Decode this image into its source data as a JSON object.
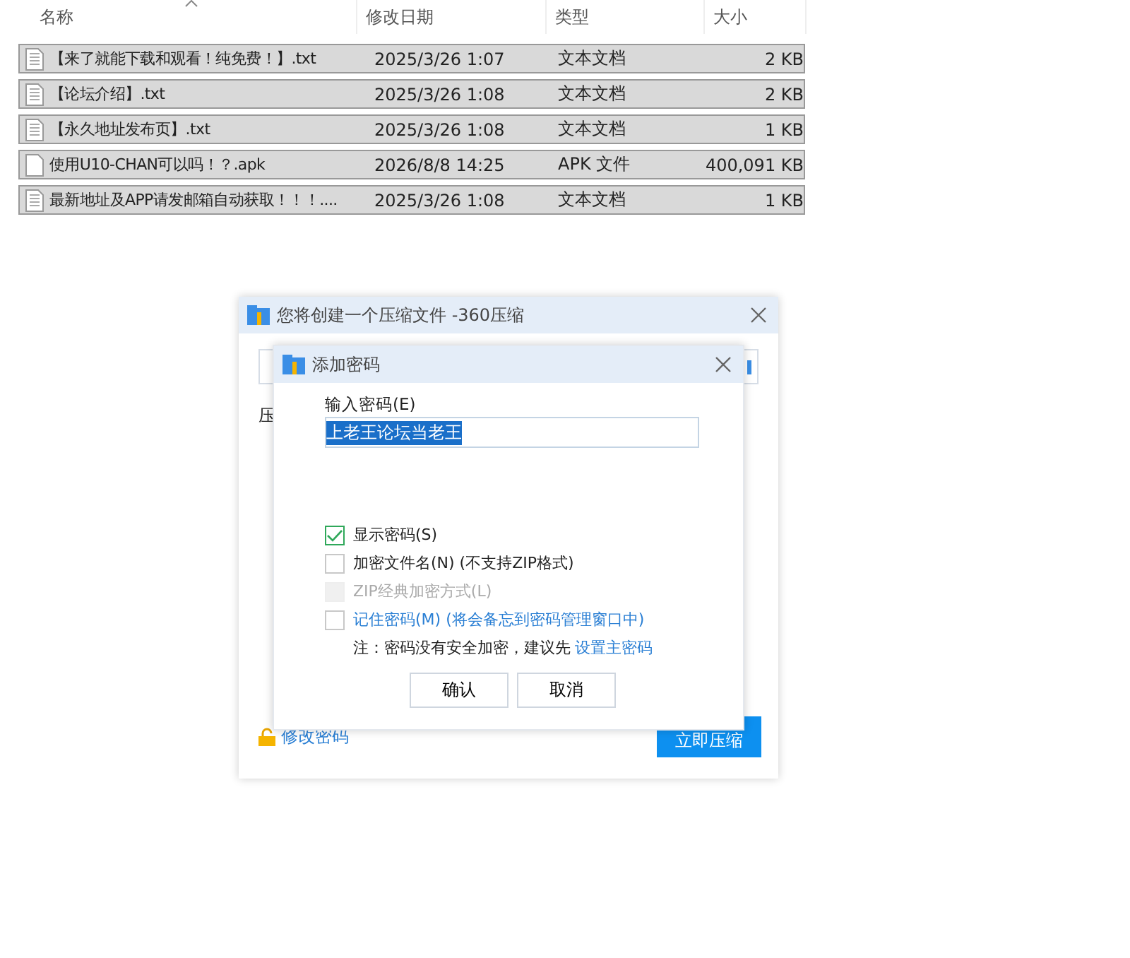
{
  "file_list": {
    "columns": [
      {
        "label": "名称",
        "sorted": true
      },
      {
        "label": "修改日期",
        "sorted": false
      },
      {
        "label": "类型",
        "sorted": false
      },
      {
        "label": "大小",
        "sorted": false
      }
    ],
    "rows": [
      {
        "name": "【来了就能下载和观看！纯免费！】.txt",
        "date": "2025/3/26 1:07",
        "type": "文本文档",
        "size": "2 KB",
        "kind": "text",
        "selected": true
      },
      {
        "name": "【论坛介绍】.txt",
        "date": "2025/3/26 1:08",
        "type": "文本文档",
        "size": "2 KB",
        "kind": "text",
        "selected": true
      },
      {
        "name": "【永久地址发布页】.txt",
        "date": "2025/3/26 1:08",
        "type": "文本文档",
        "size": "1 KB",
        "kind": "text",
        "selected": true
      },
      {
        "name": "使用U10-CHAN可以吗！？.apk",
        "date": "2026/8/8 14:25",
        "type": "APK 文件",
        "size": "400,091 KB",
        "kind": "blank",
        "selected": true
      },
      {
        "name": "最新地址及APP请发邮箱自动获取！！！....",
        "date": "2025/3/26 1:08",
        "type": "文本文档",
        "size": "1 KB",
        "kind": "text",
        "selected": true
      }
    ]
  },
  "compress_dialog": {
    "title": "您将创建一个压缩文件 -360压缩",
    "label": "压",
    "change_password_link": "修改密码",
    "compress_button": "立即压缩"
  },
  "password_dialog": {
    "title": "添加密码",
    "password_label": "输入密码(E)",
    "password_value": "上老王论坛当老王",
    "options": [
      {
        "label": "显示密码(S)",
        "checked": true,
        "disabled": false,
        "link": false
      },
      {
        "label": "加密文件名(N) (不支持ZIP格式)",
        "checked": false,
        "disabled": false,
        "link": false
      },
      {
        "label": "ZIP经典加密方式(L)",
        "checked": false,
        "disabled": true,
        "link": false
      },
      {
        "label": "记住密码(M) (将会备忘到密码管理窗口中)",
        "checked": false,
        "disabled": false,
        "link": true
      }
    ],
    "note": "注：密码没有安全加密，建议先",
    "note_link": "设置主密码",
    "buttons": [
      "确认",
      "取消"
    ]
  }
}
